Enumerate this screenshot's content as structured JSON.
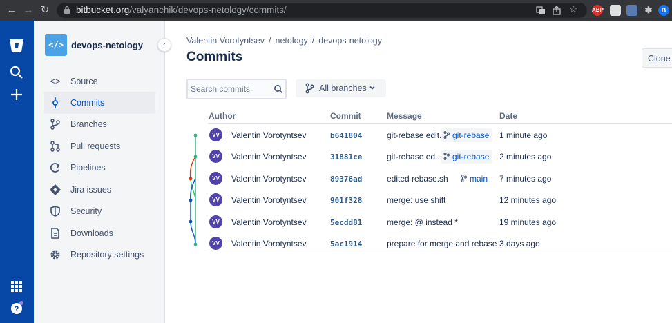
{
  "browser": {
    "url_host": "bitbucket.org",
    "url_path": "/valyanchik/devops-netology/commits/",
    "ext_abp": "ABP",
    "profile_initial": "B"
  },
  "repo": {
    "avatar_glyph": "</>",
    "name": "devops-netology"
  },
  "sidebar": {
    "items": [
      {
        "label": "Source",
        "icon": "code-icon"
      },
      {
        "label": "Commits",
        "icon": "commit-icon",
        "active": true
      },
      {
        "label": "Branches",
        "icon": "branch-icon"
      },
      {
        "label": "Pull requests",
        "icon": "pull-request-icon"
      },
      {
        "label": "Pipelines",
        "icon": "pipelines-icon"
      },
      {
        "label": "Jira issues",
        "icon": "jira-icon"
      },
      {
        "label": "Security",
        "icon": "shield-icon"
      },
      {
        "label": "Downloads",
        "icon": "document-icon"
      },
      {
        "label": "Repository settings",
        "icon": "gear-icon"
      }
    ]
  },
  "breadcrumb": {
    "user": "Valentin Vorotyntsev",
    "sep": "/",
    "project": "netology",
    "repo": "devops-netology"
  },
  "page": {
    "title": "Commits",
    "clone_label": "Clone"
  },
  "search": {
    "placeholder": "Search commits"
  },
  "branch_filter": {
    "label": "All branches"
  },
  "table": {
    "headers": {
      "author": "Author",
      "commit": "Commit",
      "message": "Message",
      "date": "Date"
    },
    "rows": [
      {
        "initials": "VV",
        "author": "Valentin Vorotyntsev",
        "hash": "b641804",
        "message": "git-rebase edit...",
        "branch": "git-rebase",
        "date": "1 minute ago"
      },
      {
        "initials": "VV",
        "author": "Valentin Vorotyntsev",
        "hash": "31881ce",
        "message": "git-rebase ed...",
        "branch": "git-rebase",
        "date": "2 minutes ago"
      },
      {
        "initials": "VV",
        "author": "Valentin Vorotyntsev",
        "hash": "89376ad",
        "message": "edited rebase.sh",
        "branch": "main",
        "date": "7 minutes ago"
      },
      {
        "initials": "VV",
        "author": "Valentin Vorotyntsev",
        "hash": "901f328",
        "message": "merge: use shift",
        "branch": "",
        "date": "12 minutes ago"
      },
      {
        "initials": "VV",
        "author": "Valentin Vorotyntsev",
        "hash": "5ecdd81",
        "message": "merge: @ instead *",
        "branch": "",
        "date": "19 minutes ago"
      },
      {
        "initials": "VV",
        "author": "Valentin Vorotyntsev",
        "hash": "5ac1914",
        "message": "prepare for merge and rebase",
        "branch": "",
        "date": "3 days ago"
      }
    ]
  },
  "colors": {
    "global_nav": "#0747a6",
    "accent": "#0052cc",
    "graph_green": "#36b37e",
    "graph_blue": "#0052cc",
    "graph_red": "#de350b"
  }
}
